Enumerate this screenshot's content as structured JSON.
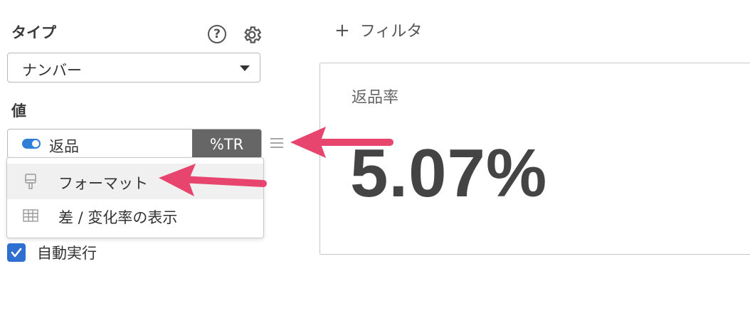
{
  "sidebar": {
    "type_label": "タイプ",
    "type_select_value": "ナンバー",
    "value_label": "値",
    "value_field": {
      "text": "返品",
      "badge": "%TR"
    },
    "dropdown": {
      "items": [
        {
          "label": "フォーマット",
          "icon": "paint-brush-icon"
        },
        {
          "label": "差 / 変化率の表示",
          "icon": "table-icon"
        }
      ]
    },
    "auto_run_label": "自動実行",
    "auto_run_checked": true
  },
  "main": {
    "filter_label": "フィルタ",
    "card": {
      "title": "返品率",
      "value": "5.07%"
    }
  },
  "colors": {
    "accent": "#2f6fd1",
    "badge_bg": "#666666",
    "annotation_arrow": "#e8456e"
  }
}
